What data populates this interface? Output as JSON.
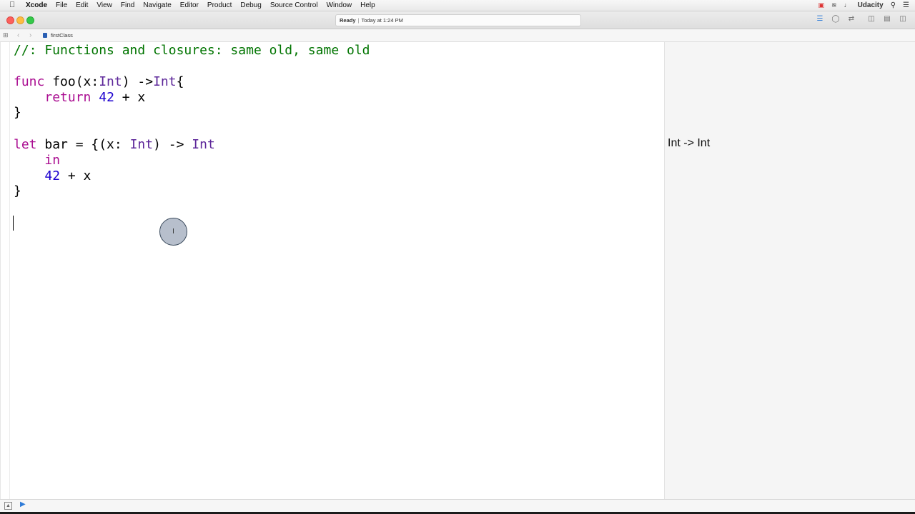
{
  "menubar": {
    "apple_icon": "apple-logo",
    "items": [
      "Xcode",
      "File",
      "Edit",
      "View",
      "Find",
      "Navigate",
      "Editor",
      "Product",
      "Debug",
      "Source Control",
      "Window",
      "Help"
    ],
    "status_icons": [
      "calendar-icon",
      "wifi-icon",
      "volume-icon"
    ],
    "user": "Udacity",
    "right_icons": [
      "search-icon",
      "list-icon"
    ]
  },
  "toolbar": {
    "status": "Ready",
    "separator": "|",
    "timestamp": "Today at 1:24 PM",
    "icons": [
      "standard-editor-icon",
      "assistant-editor-icon",
      "version-editor-icon",
      "navigator-toggle-icon",
      "debug-area-toggle-icon",
      "utilities-toggle-icon"
    ]
  },
  "jumpbar": {
    "filename": "firstClass"
  },
  "editor": {
    "lines": [
      [
        {
          "t": "cm",
          "v": "//: Functions and closures: same old, same old"
        }
      ],
      [],
      [
        {
          "t": "kw",
          "v": "func"
        },
        {
          "t": "pl",
          "v": " foo(x:"
        },
        {
          "t": "ty",
          "v": "Int"
        },
        {
          "t": "pl",
          "v": ") ->"
        },
        {
          "t": "ty",
          "v": "Int"
        },
        {
          "t": "pl",
          "v": "{"
        }
      ],
      [
        {
          "t": "pl",
          "v": "    "
        },
        {
          "t": "kw",
          "v": "return"
        },
        {
          "t": "pl",
          "v": " "
        },
        {
          "t": "num",
          "v": "42"
        },
        {
          "t": "pl",
          "v": " + x"
        }
      ],
      [
        {
          "t": "pl",
          "v": "}"
        }
      ],
      [],
      [
        {
          "t": "kw",
          "v": "let"
        },
        {
          "t": "pl",
          "v": " bar = {(x: "
        },
        {
          "t": "ty",
          "v": "Int"
        },
        {
          "t": "pl",
          "v": ") -> "
        },
        {
          "t": "ty",
          "v": "Int"
        }
      ],
      [
        {
          "t": "pl",
          "v": "    "
        },
        {
          "t": "kw",
          "v": "in"
        }
      ],
      [
        {
          "t": "pl",
          "v": "    "
        },
        {
          "t": "num",
          "v": "42"
        },
        {
          "t": "pl",
          "v": " + x"
        }
      ],
      [
        {
          "t": "pl",
          "v": "}"
        }
      ]
    ]
  },
  "results": {
    "bar_type": "Int -> Int"
  },
  "colors": {
    "keyword": "#aa0d91",
    "type": "#5c2699",
    "number": "#1c00cf",
    "comment": "#007400"
  }
}
